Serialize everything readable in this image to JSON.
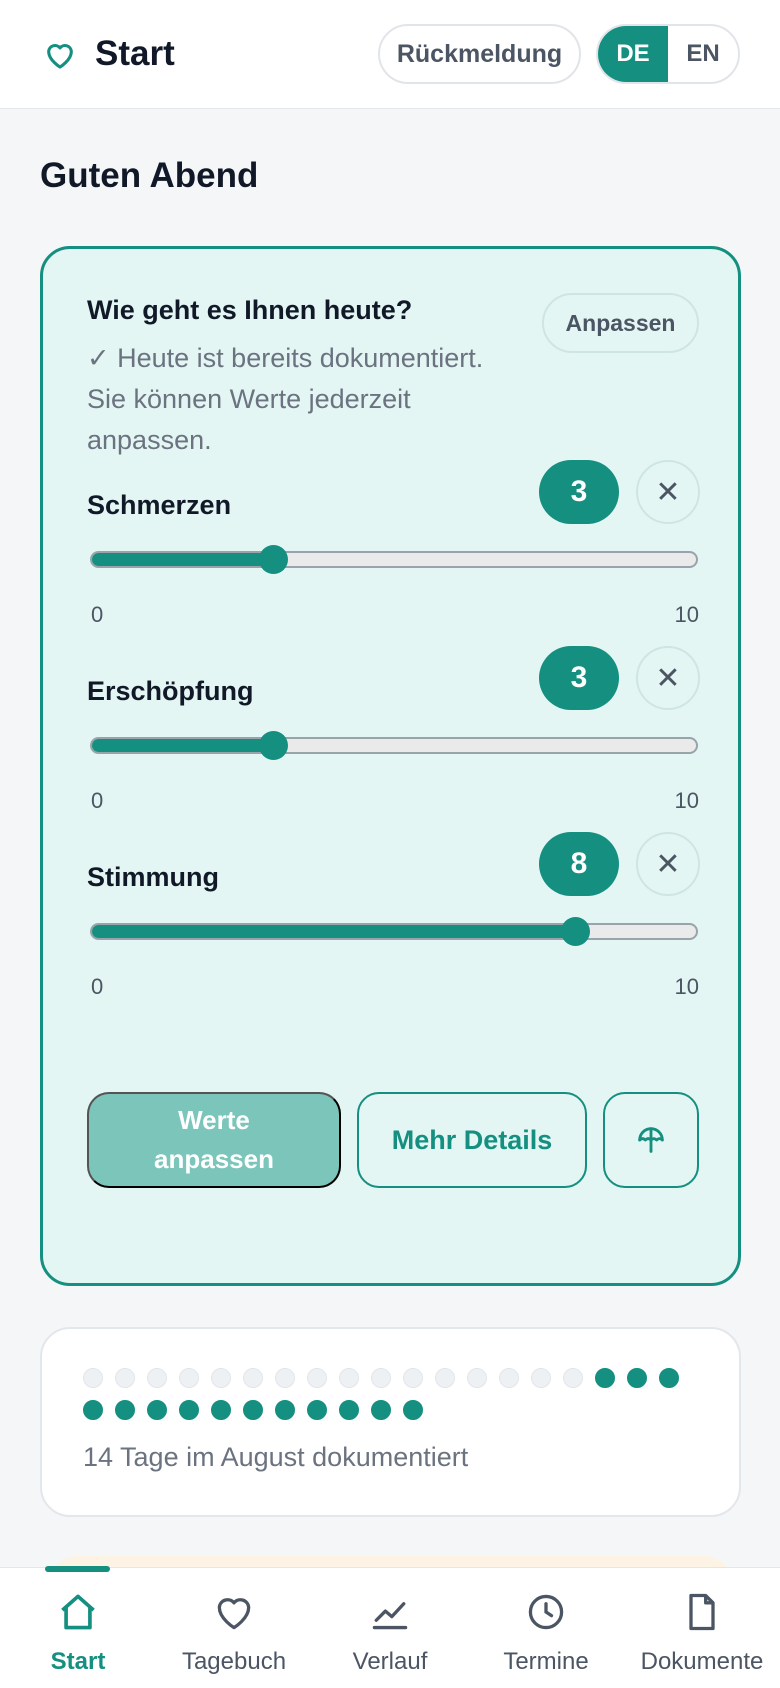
{
  "header": {
    "title": "Start",
    "feedback_label": "Rückmeldung",
    "languages": [
      {
        "label": "DE",
        "active": true
      },
      {
        "label": "EN",
        "active": false
      }
    ]
  },
  "greeting": "Guten Abend",
  "checkin": {
    "question": "Wie geht es Ihnen heute?",
    "info": "✓ Heute ist bereits dokumentiert. Sie können Werte jederzeit anpassen.",
    "adjust_label": "Anpassen",
    "metrics": [
      {
        "label": "Schmerzen",
        "value": "3",
        "level": 0.3,
        "min": "0",
        "max": "10"
      },
      {
        "label": "Erschöpfung",
        "value": "3",
        "level": 0.3,
        "min": "0",
        "max": "10"
      },
      {
        "label": "Stimmung",
        "value": "8",
        "level": 0.8,
        "min": "0",
        "max": "10"
      }
    ],
    "clear_symbol": "✕",
    "primary_button": "Werte anpassen",
    "details_button": "Mehr Details",
    "extra_button_icon": "umbrella-icon"
  },
  "month": {
    "days_documented": [
      false,
      false,
      false,
      false,
      false,
      false,
      false,
      false,
      false,
      false,
      false,
      false,
      false,
      false,
      false,
      false,
      true,
      true,
      true,
      true,
      true,
      true,
      true,
      true,
      true,
      true,
      true,
      true,
      true,
      true
    ],
    "summary": "14 Tage im August dokumentiert"
  },
  "nav": {
    "items": [
      {
        "label": "Start",
        "icon": "home-icon",
        "active": true
      },
      {
        "label": "Tagebuch",
        "icon": "heart-icon",
        "active": false
      },
      {
        "label": "Verlauf",
        "icon": "chart-line-icon",
        "active": false
      },
      {
        "label": "Termine",
        "icon": "clock-icon",
        "active": false
      },
      {
        "label": "Dokumente",
        "icon": "document-icon",
        "active": false
      }
    ]
  },
  "colors": {
    "accent": "#148f80",
    "card_background": "#e3f6f3",
    "primary_disabled": "#7bc5bb"
  }
}
